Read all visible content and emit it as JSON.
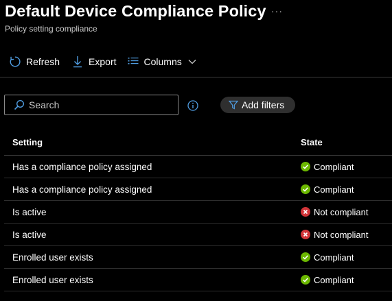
{
  "header": {
    "title": "Default Device Compliance Policy",
    "more_label": "···",
    "subtitle": "Policy setting compliance"
  },
  "toolbar": {
    "refresh_label": "Refresh",
    "export_label": "Export",
    "columns_label": "Columns"
  },
  "search": {
    "placeholder": "Search",
    "value": ""
  },
  "filters": {
    "add_label": "Add filters"
  },
  "table": {
    "columns": [
      "Setting",
      "State"
    ],
    "rows": [
      {
        "setting": "Has a compliance policy assigned",
        "state": "Compliant",
        "status": "ok"
      },
      {
        "setting": "Has a compliance policy assigned",
        "state": "Compliant",
        "status": "ok"
      },
      {
        "setting": "Is active",
        "state": "Not compliant",
        "status": "error"
      },
      {
        "setting": "Is active",
        "state": "Not compliant",
        "status": "error"
      },
      {
        "setting": "Enrolled user exists",
        "state": "Compliant",
        "status": "ok"
      },
      {
        "setting": "Enrolled user exists",
        "state": "Compliant",
        "status": "ok"
      }
    ]
  },
  "colors": {
    "background": "#000000",
    "accent": "#4f9ce0",
    "compliant": "#6bb700",
    "not_compliant": "#d13438"
  }
}
